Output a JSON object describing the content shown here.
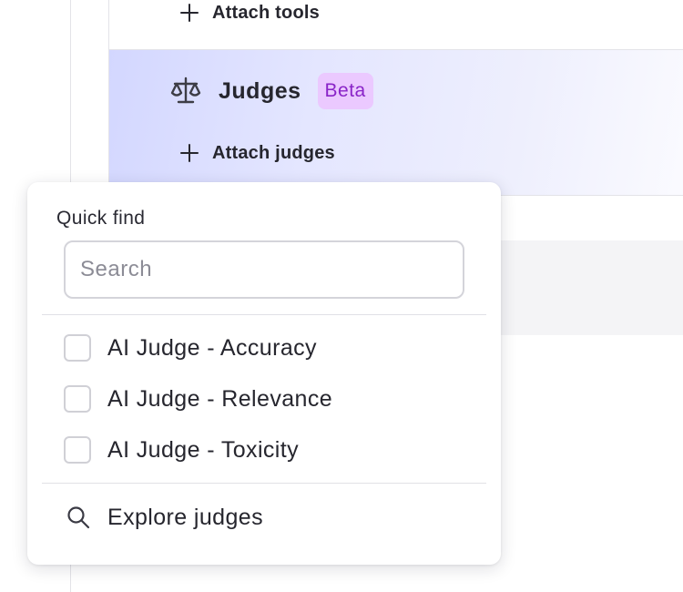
{
  "tools_section": {
    "attach_label": "Attach tools",
    "plus_icon": "plus-icon"
  },
  "judges_section": {
    "title": "Judges",
    "badge": "Beta",
    "icon": "scale-icon",
    "attach_label": "Attach judges",
    "plus_icon": "plus-icon",
    "colors": {
      "badge_bg": "#ebc9ff",
      "badge_text": "#8a24c8",
      "highlight_start": "#d3d7ff"
    }
  },
  "quick_find": {
    "label": "Quick find",
    "search_placeholder": "Search",
    "search_value": "",
    "options": [
      {
        "label": "AI Judge - Accuracy",
        "checked": false
      },
      {
        "label": "AI Judge - Relevance",
        "checked": false
      },
      {
        "label": "AI Judge - Toxicity",
        "checked": false
      }
    ],
    "explore_label": "Explore judges",
    "explore_icon": "search-icon"
  }
}
